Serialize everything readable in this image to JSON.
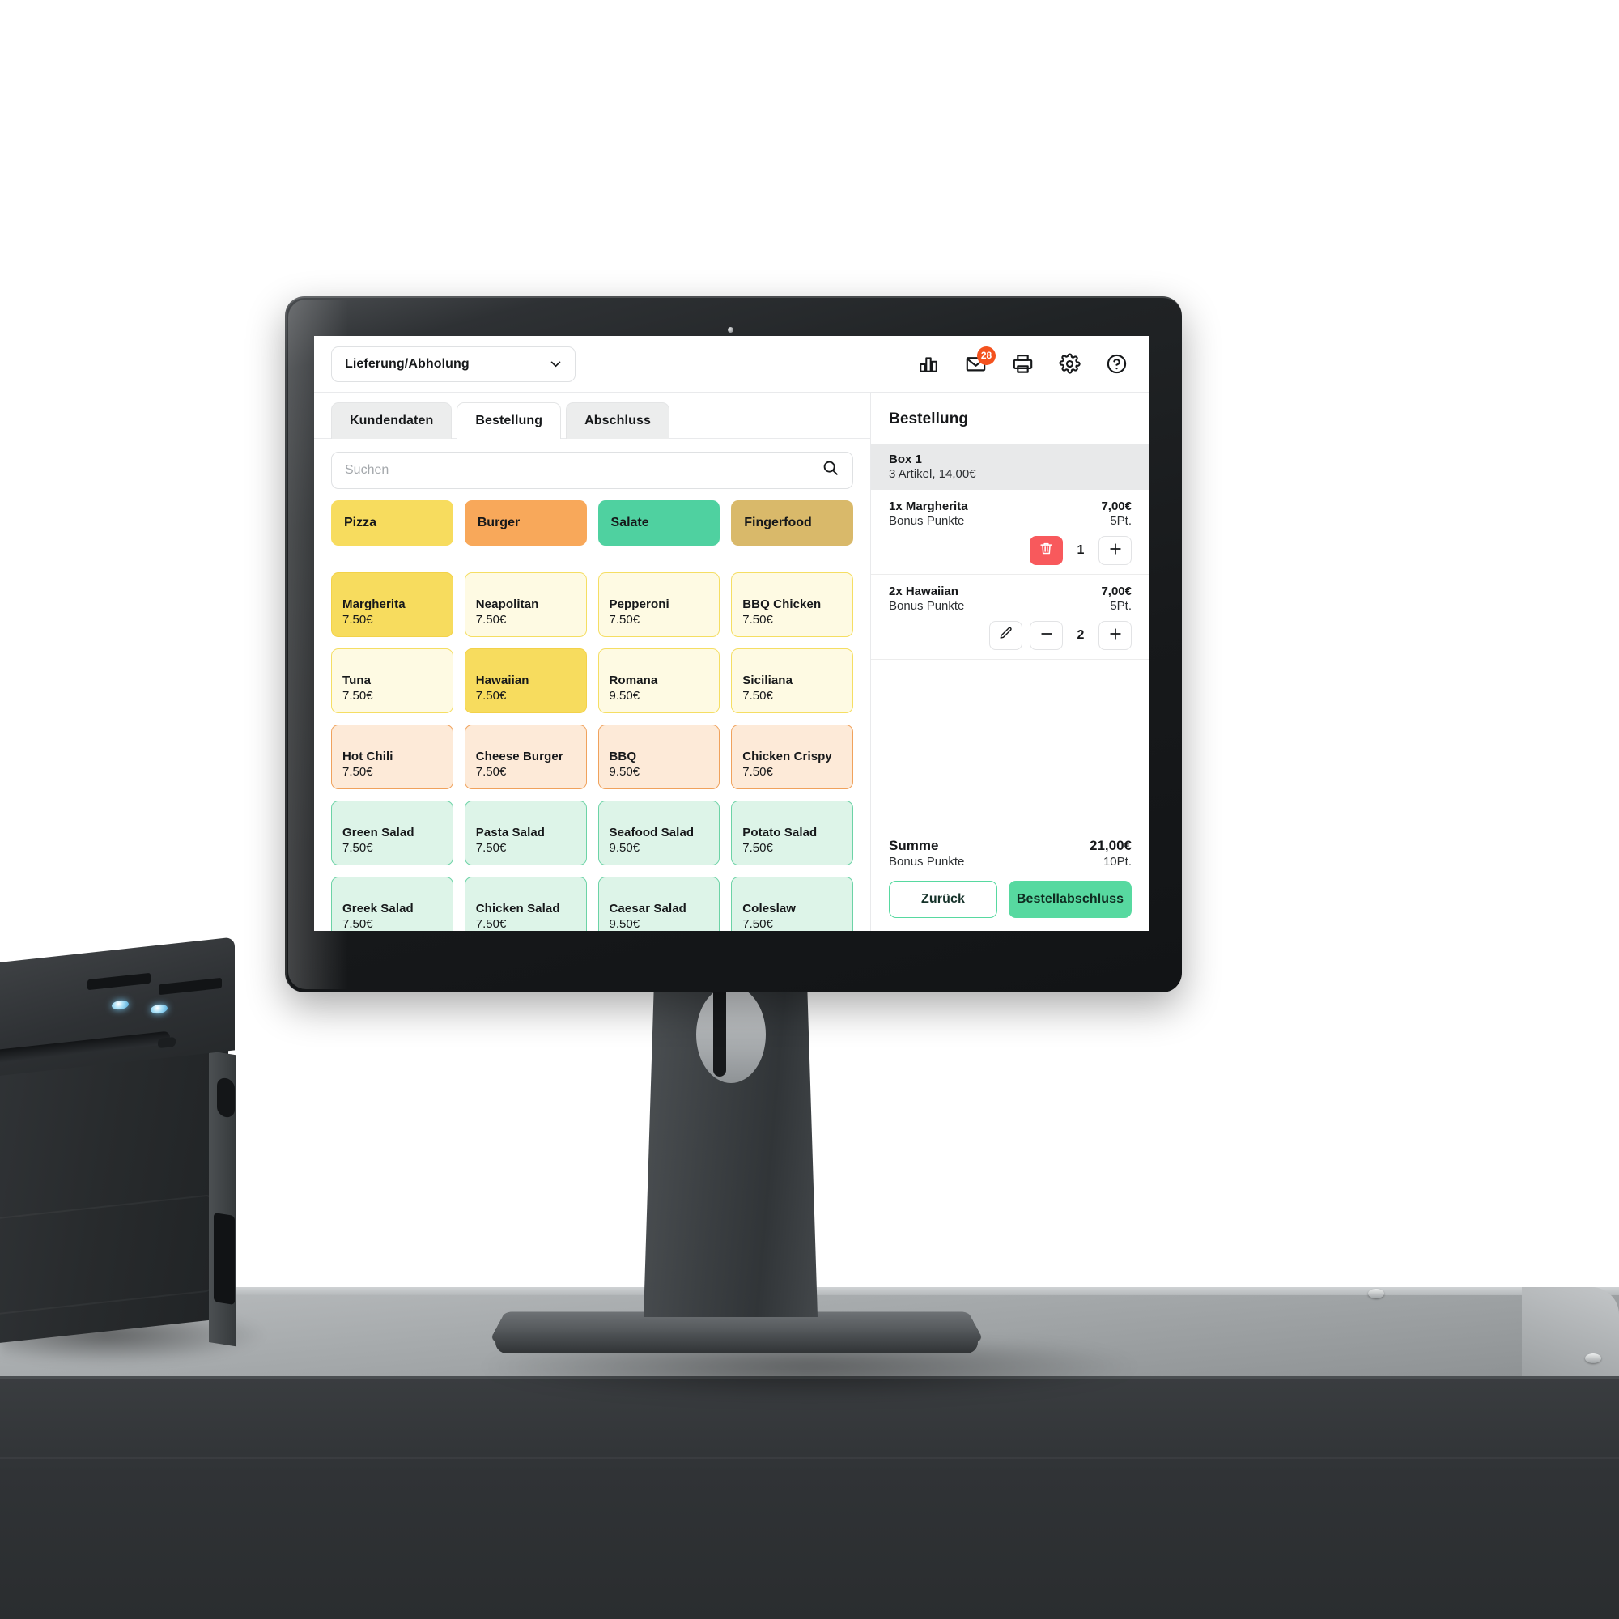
{
  "app": {
    "order_type": {
      "label": "Lieferung/Abholung"
    },
    "header_icons": [
      {
        "name": "bar-chart-icon",
        "badge": null
      },
      {
        "name": "envelope-icon",
        "badge": "28"
      },
      {
        "name": "printer-icon",
        "badge": null
      },
      {
        "name": "gear-icon",
        "badge": null
      },
      {
        "name": "help-icon",
        "badge": null
      }
    ],
    "tabs": [
      {
        "label": "Kundendaten",
        "active": false
      },
      {
        "label": "Bestellung",
        "active": true
      },
      {
        "label": "Abschluss",
        "active": false
      }
    ],
    "search": {
      "placeholder": "Suchen",
      "value": "",
      "icon": "search-icon"
    },
    "categories": [
      {
        "label": "Pizza",
        "color": "#F7DC5E"
      },
      {
        "label": "Burger",
        "color": "#F8A85A"
      },
      {
        "label": "Salate",
        "color": "#4FD1A0"
      },
      {
        "label": "Fingerfood",
        "color": "#D9B96A"
      }
    ],
    "products": [
      {
        "name": "Margherita",
        "price": "7.50€",
        "bg": "#F7DC5E",
        "border": "#F3D249",
        "selected": true
      },
      {
        "name": "Neapolitan",
        "price": "7.50€",
        "bg": "#FEFAE3",
        "border": "#F5DE63",
        "selected": false
      },
      {
        "name": "Pepperoni",
        "price": "7.50€",
        "bg": "#FEFAE3",
        "border": "#F5DE63",
        "selected": false
      },
      {
        "name": "BBQ Chicken",
        "price": "7.50€",
        "bg": "#FEFAE3",
        "border": "#F5DE63",
        "selected": false
      },
      {
        "name": "Tuna",
        "price": "7.50€",
        "bg": "#FEFAE3",
        "border": "#F5DE63",
        "selected": false
      },
      {
        "name": "Hawaiian",
        "price": "7.50€",
        "bg": "#F7DC5E",
        "border": "#F3D249",
        "selected": true
      },
      {
        "name": "Romana",
        "price": "9.50€",
        "bg": "#FEFAE3",
        "border": "#F5DE63",
        "selected": false
      },
      {
        "name": "Siciliana",
        "price": "7.50€",
        "bg": "#FEFAE3",
        "border": "#F5DE63",
        "selected": false
      },
      {
        "name": "Hot Chili",
        "price": "7.50€",
        "bg": "#FDEAD8",
        "border": "#F0A25C",
        "selected": false
      },
      {
        "name": "Cheese Burger",
        "price": "7.50€",
        "bg": "#FDEAD8",
        "border": "#F0A25C",
        "selected": false
      },
      {
        "name": "BBQ",
        "price": "9.50€",
        "bg": "#FDEAD8",
        "border": "#F0A25C",
        "selected": false
      },
      {
        "name": "Chicken Crispy",
        "price": "7.50€",
        "bg": "#FDEAD8",
        "border": "#F0A25C",
        "selected": false
      },
      {
        "name": "Green Salad",
        "price": "7.50€",
        "bg": "#DDF4E8",
        "border": "#6CD3A6",
        "selected": false
      },
      {
        "name": "Pasta Salad",
        "price": "7.50€",
        "bg": "#DDF4E8",
        "border": "#6CD3A6",
        "selected": false
      },
      {
        "name": "Seafood Salad",
        "price": "9.50€",
        "bg": "#DDF4E8",
        "border": "#6CD3A6",
        "selected": false
      },
      {
        "name": "Potato Salad",
        "price": "7.50€",
        "bg": "#DDF4E8",
        "border": "#6CD3A6",
        "selected": false
      },
      {
        "name": "Greek Salad",
        "price": "7.50€",
        "bg": "#DDF4E8",
        "border": "#6CD3A6",
        "selected": false
      },
      {
        "name": "Chicken Salad",
        "price": "7.50€",
        "bg": "#DDF4E8",
        "border": "#6CD3A6",
        "selected": false
      },
      {
        "name": "Caesar Salad",
        "price": "9.50€",
        "bg": "#DDF4E8",
        "border": "#6CD3A6",
        "selected": false
      },
      {
        "name": "Coleslaw",
        "price": "7.50€",
        "bg": "#DDF4E8",
        "border": "#6CD3A6",
        "selected": false
      }
    ],
    "order_panel": {
      "title": "Bestellung",
      "box": {
        "title": "Box 1",
        "subtitle": "3 Artikel, 14,00€"
      },
      "items": [
        {
          "name": "1x Margherita",
          "price": "7,00€",
          "bonus_label": "Bonus Punkte",
          "points": "5Pt.",
          "qty": "1",
          "controls": [
            "trash",
            "qty",
            "plus"
          ]
        },
        {
          "name": "2x Hawaiian",
          "price": "7,00€",
          "bonus_label": "Bonus Punkte",
          "points": "5Pt.",
          "qty": "2",
          "controls": [
            "edit",
            "minus",
            "qty",
            "plus"
          ]
        }
      ],
      "summary": {
        "label": "Summe",
        "total": "21,00€",
        "bonus_label": "Bonus Punkte",
        "bonus_points": "10Pt."
      },
      "buttons": {
        "back": "Zurück",
        "finish": "Bestellabschluss"
      }
    }
  },
  "theme": {
    "accent_green": "#57D9A0",
    "badge_red": "#F4521E",
    "danger_red": "#F8595C",
    "tab_inactive": "#eceded"
  }
}
